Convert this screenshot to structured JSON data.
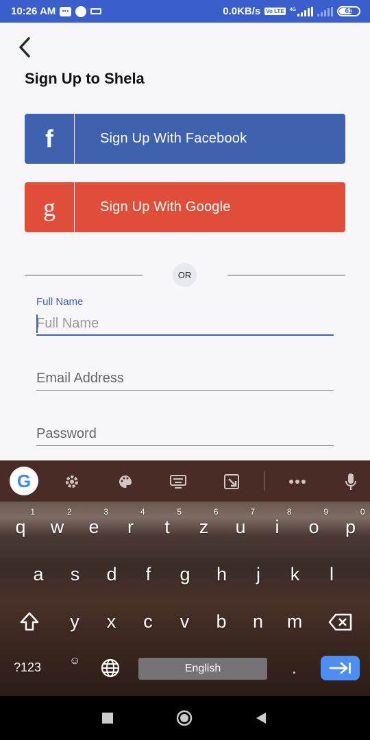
{
  "status_bar": {
    "time": "10:26 AM",
    "network_speed": "0.0KB/s",
    "volte_tag": "Vo LTE",
    "net_type": "4G",
    "battery": "61"
  },
  "header": {
    "title": "Sign Up to Shela"
  },
  "social": {
    "facebook_label": "Sign Up With Facebook",
    "google_label": "Sign Up With Google",
    "facebook_color": "#3f62ae",
    "google_color": "#e04d39"
  },
  "divider": {
    "or_text": "OR"
  },
  "form": {
    "full_name_label": "Full Name",
    "full_name_placeholder": "Full Name",
    "email_placeholder": "Email Address",
    "password_placeholder": "Password",
    "accent_color": "#3a5fcd"
  },
  "keyboard": {
    "row1": [
      "q",
      "w",
      "e",
      "r",
      "t",
      "z",
      "u",
      "i",
      "o",
      "p"
    ],
    "row1_numbers": [
      "1",
      "2",
      "3",
      "4",
      "5",
      "6",
      "7",
      "8",
      "9",
      "0"
    ],
    "row2": [
      "a",
      "s",
      "d",
      "f",
      "g",
      "h",
      "j",
      "k",
      "l"
    ],
    "row3": [
      "y",
      "x",
      "c",
      "v",
      "b",
      "n",
      "m"
    ],
    "symbols_key": "?123",
    "period_key": ".",
    "space_label": "English",
    "toolbar_icons": [
      "google-icon",
      "settings-icon",
      "theme-icon",
      "keyboard-icon",
      "resize-icon",
      "more-icon",
      "mic-icon"
    ]
  },
  "nav_bar": {
    "buttons": [
      "recents-icon",
      "home-icon",
      "back-icon"
    ]
  }
}
